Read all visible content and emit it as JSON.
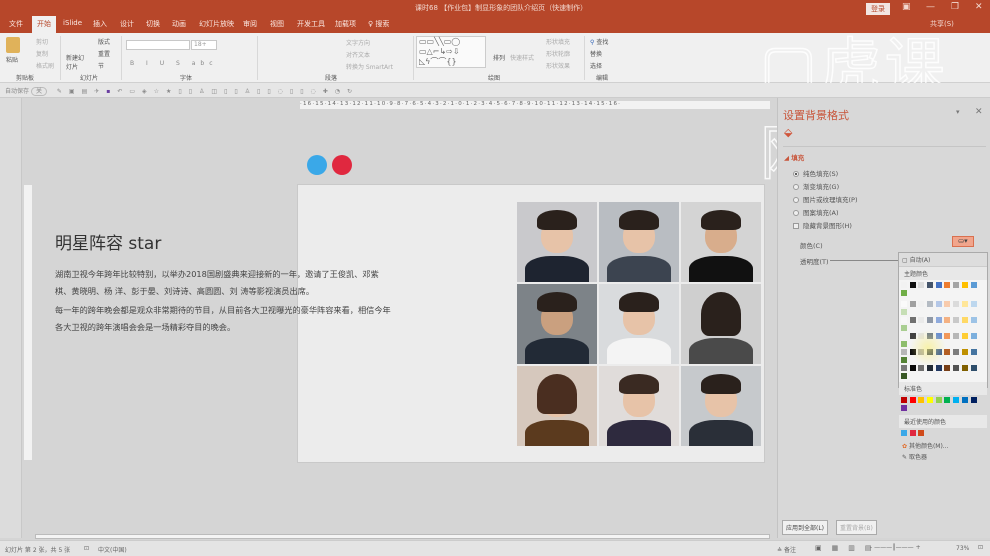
{
  "window": {
    "title": "课时68 【作业包】制显形象的团队介绍页（快速制作）",
    "login": "登录",
    "share": "共享(S)",
    "watermark": "虎课网"
  },
  "tabs": [
    "文件",
    "开始",
    "iSlide",
    "插入",
    "设计",
    "切换",
    "动画",
    "幻灯片放映",
    "审阅",
    "视图",
    "开发工具",
    "加载项",
    "搜索"
  ],
  "ribbon": {
    "clipboard": {
      "paste": "粘贴",
      "cut": "剪切",
      "copy": "复制",
      "format": "格式刷",
      "label": "剪贴板"
    },
    "slides": {
      "new": "新建幻灯片",
      "layout": "版式",
      "reset": "重置",
      "section": "节",
      "label": "幻灯片"
    },
    "font": {
      "size": "18+",
      "label": "字体"
    },
    "paragraph": {
      "text_direction": "文字方向",
      "align_text": "对齐文本",
      "smartart": "转换为 SmartArt",
      "label": "段落"
    },
    "drawing": {
      "arrange": "排列",
      "quick_styles": "快速样式",
      "fill": "形状填充",
      "outline": "形状轮廓",
      "effects": "形状效果",
      "label": "绘图"
    },
    "editing": {
      "find": "查找",
      "replace": "替换",
      "select": "选择",
      "label": "编辑"
    }
  },
  "qat": {
    "autosave": "自动保存",
    "toggle": "关"
  },
  "ruler_top": "·16·15·14·13·12·11·10·9·8·7·6·5·4·3·2·1·0·1·2·3·4·5·6·7·8·9·10·11·12·13·14·15·16·",
  "slide": {
    "dot_colors": [
      "#3aa8e8",
      "#e0283f"
    ],
    "heading": "明星阵容  star",
    "para1": "湖南卫视今年跨年比较特别，以举办2018国剧盛典来迎接新的一年，邀请了王俊凯、邓紫棋、黄晓明、杨 洋、彭于晏、刘诗诗、高圆圆、刘 涛等影视演员出席。",
    "para2": "每一年的跨年晚会都是观众非常期待的节目，从目前各大卫视曝光的豪华阵容来看，相信今年各大卫视的跨年演唱会会是一场精彩夺目的晚会。"
  },
  "pane": {
    "title": "设置背景格式",
    "section": "填充",
    "options": [
      "纯色填充(S)",
      "渐变填充(G)",
      "图片或纹理填充(P)",
      "图案填充(A)"
    ],
    "selected_option": 0,
    "hide_bg": "隐藏背景图形(H)",
    "color_label": "颜色(C)",
    "transparency_label": "透明度(T)",
    "apply_all": "应用到全部(L)",
    "reset_bg": "重置背景(B)"
  },
  "palette": {
    "auto": "自动(A)",
    "theme_label": "主题颜色",
    "theme_top": [
      "#f2f2f2",
      "#111111",
      "#dcdcdc",
      "#44546a",
      "#4472c4",
      "#ed7d31",
      "#a5a5a5",
      "#ffc000",
      "#5b9bd5",
      "#70ad47"
    ],
    "standard_label": "标准色",
    "standard": [
      "#c00000",
      "#ff0000",
      "#ffc000",
      "#ffff00",
      "#92d050",
      "#00b050",
      "#00b0f0",
      "#0070c0",
      "#002060",
      "#7030a0"
    ],
    "recent_label": "最近使用的颜色",
    "recent": [
      "#3aa8e8",
      "#e0283f",
      "#d04a1a"
    ],
    "more": "其他颜色(M)...",
    "eyedropper": "取色器"
  },
  "status": {
    "slide": "幻灯片 第 2 张，共 5 张",
    "lang": "中文(中国)",
    "notes": "备注",
    "zoom": "73%"
  }
}
